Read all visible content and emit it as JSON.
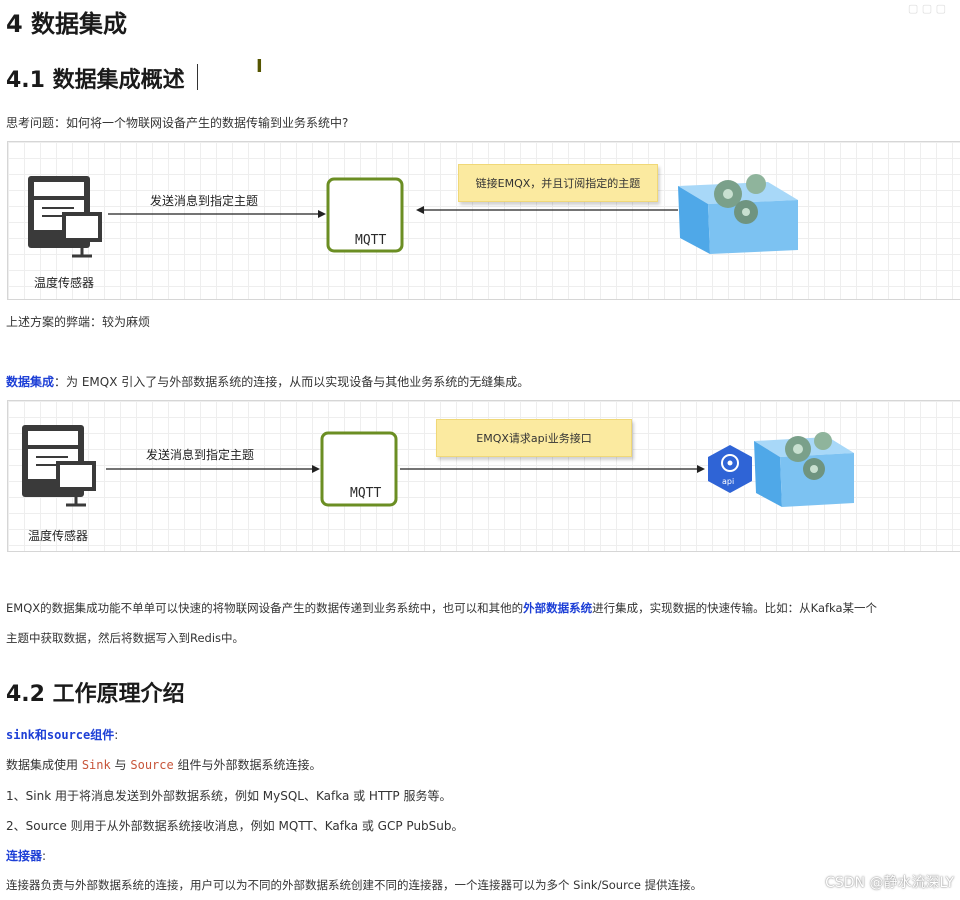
{
  "heading_main": "4 数据集成",
  "heading_41": "4.1 数据集成概述",
  "question": "思考问题：如何将一个物联网设备产生的数据传输到业务系统中?",
  "diagram1": {
    "sensor_label": "温度传感器",
    "arrow_label": "发送消息到指定主题",
    "broker_label": "MQTT",
    "note": "链接EMQX，并且订阅指定的主题"
  },
  "drawback": "上述方案的弊端：较为麻烦",
  "integration": {
    "term": "数据集成",
    "rest": "：为 EMQX 引入了与外部数据系统的连接，从而以实现设备与其他业务系统的无缝集成。"
  },
  "diagram2": {
    "sensor_label": "温度传感器",
    "arrow_label": "发送消息到指定主题",
    "broker_label": "MQTT",
    "note": "EMQX请求api业务接口",
    "api_label": "api"
  },
  "para_line1": {
    "part1": "EMQX的数据集成功能不单单可以快速的将物联网设备产生的数据传递到业务系统中，也可以和其他的",
    "highlight": "外部数据系统",
    "part2": "进行集成，实现数据的快速传输。比如：从Kafka某一个"
  },
  "para_line2": "主题中获取数据，然后将数据写入到Redis中。",
  "heading_42": "4.2 工作原理介绍",
  "sink_source_title": "sink和source组件",
  "sink_source_colon": ":",
  "usage": {
    "part1": "数据集成使用 ",
    "sink": "Sink",
    "mid": " 与 ",
    "source": "Source",
    "part2": " 组件与外部数据系统连接。"
  },
  "item1": "1、Sink 用于将消息发送到外部数据系统，例如 MySQL、Kafka 或 HTTP  服务等。",
  "item2": "2、Source 则用于从外部数据系统接收消息，例如 MQTT、Kafka 或 GCP PubSub。",
  "connector_title": "连接器",
  "connector_colon": ":",
  "connector_desc": "连接器负责与外部数据系统的连接，用户可以为不同的外部数据系统创建不同的连接器，一个连接器可以为多个 Sink/Source 提供连接。",
  "watermark": "CSDN @静水流深LY",
  "colors": {
    "mqtt_green": "#6b8e23",
    "note_yellow": "#fbeaa0",
    "cube_blue": "#4fa8e8",
    "term_blue": "#1d3fd6",
    "code_red": "#c7553a"
  }
}
